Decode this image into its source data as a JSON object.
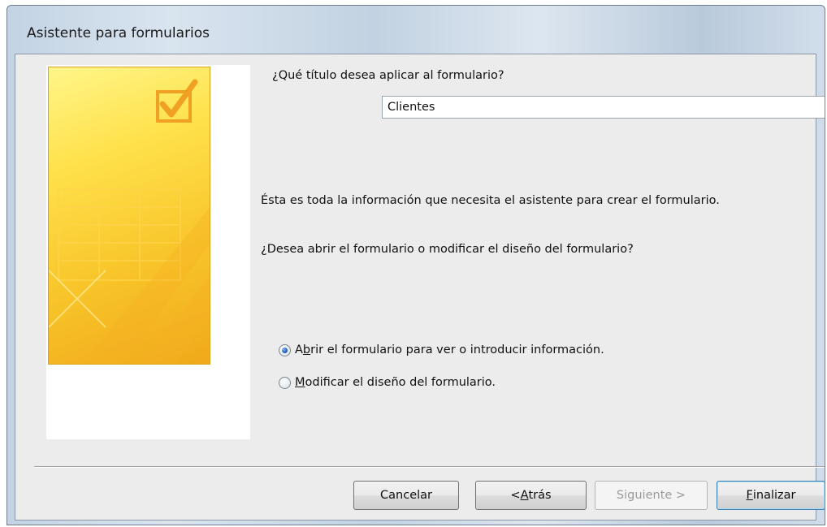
{
  "window": {
    "title": "Asistente para formularios"
  },
  "form": {
    "title_question": "¿Qué título desea aplicar al formulario?",
    "title_value": "Clientes",
    "info_text": "Ésta es toda la información que necesita el asistente para crear el formulario.",
    "open_question": "¿Desea abrir el formulario o modificar el diseño del formulario?"
  },
  "options": {
    "open": {
      "pre": "A",
      "mnemonic": "b",
      "post": "rir el formulario para ver o introducir información.",
      "checked": true
    },
    "modify": {
      "pre": "",
      "mnemonic": "M",
      "post": "odificar el diseño del formulario.",
      "checked": false
    }
  },
  "buttons": {
    "cancel": {
      "label": "Cancelar"
    },
    "back": {
      "pre": "< ",
      "mnemonic": "A",
      "post": "trás"
    },
    "next": {
      "label": "Siguiente >",
      "enabled": false
    },
    "finish": {
      "pre": "",
      "mnemonic": "F",
      "post": "inalizar",
      "default": true
    }
  },
  "icons": {
    "banner": "form-checkmark-icon"
  },
  "colors": {
    "banner_yellow": "#ffe14b",
    "banner_border": "#d9a31f",
    "dialog_bg": "#ececec",
    "radio_selected": "#1d5fb8"
  }
}
